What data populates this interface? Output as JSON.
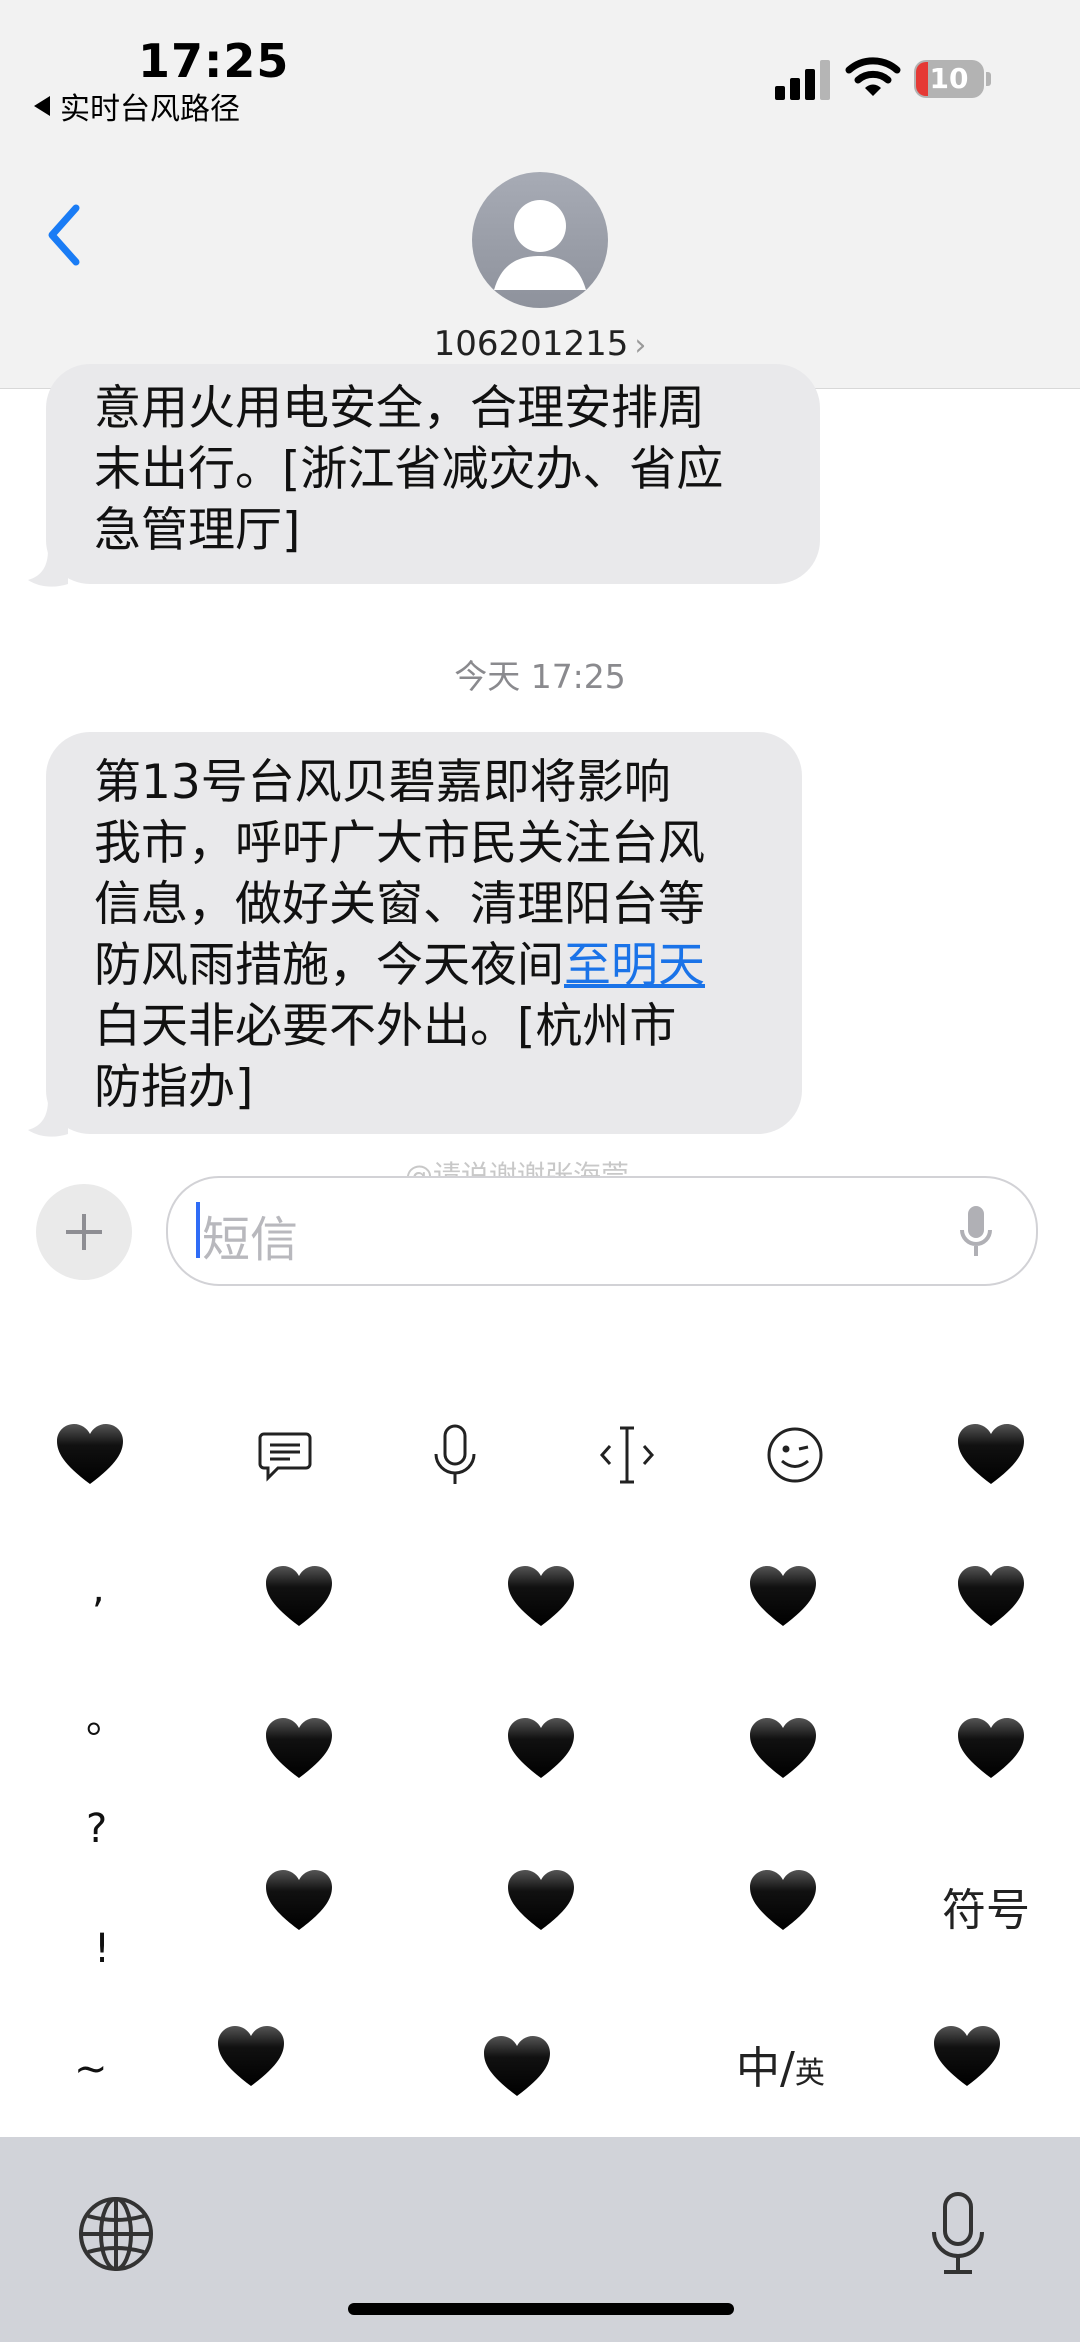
{
  "status_bar": {
    "time": "17:25",
    "back_app": "实时台风路径",
    "battery": "10"
  },
  "header": {
    "contact": "106201215",
    "chevron": "›"
  },
  "messages": {
    "previous_text": "意用火用电安全，合理安排周\n末出行。[浙江省减灾办、省应\n急管理厅]",
    "timestamp": "今天 17:25",
    "current_text_before_link": "第13号台风贝碧嘉即将影响\n我市，呼吁广大市民关注台风\n信息，做好关窗、清理阳台等\n防风雨措施，今天夜间",
    "current_link": "至明天",
    "current_text_after_link": "\n白天非必要不外出。[杭州市\n防指办]"
  },
  "watermark": "@请说谢谢张海莞",
  "input": {
    "placeholder": "短信"
  },
  "keyboard": {
    "punct": [
      ",",
      "。",
      "?",
      "!",
      "~"
    ],
    "symbols_label": "符号",
    "lang_main": "中/",
    "lang_sub": "英",
    "toolbar_icons": [
      "heart-icon",
      "chat-icon",
      "mic-icon",
      "cursor-icon",
      "emoji-icon",
      "heart-icon"
    ]
  }
}
